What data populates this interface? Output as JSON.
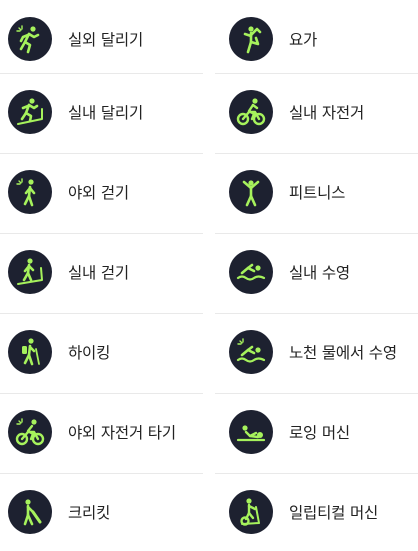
{
  "accent_color": "#a6f25c",
  "icon_bg_color": "#1d2130",
  "workouts": [
    {
      "id": "outdoor-run",
      "label": "실외 달리기",
      "icon": "outdoor-run-icon"
    },
    {
      "id": "yoga",
      "label": "요가",
      "icon": "yoga-icon"
    },
    {
      "id": "indoor-run",
      "label": "실내 달리기",
      "icon": "treadmill-run-icon"
    },
    {
      "id": "indoor-cycle",
      "label": "실내 자전거",
      "icon": "indoor-cycle-icon"
    },
    {
      "id": "outdoor-walk",
      "label": "야외 걷기",
      "icon": "outdoor-walk-icon"
    },
    {
      "id": "fitness",
      "label": "피트니스",
      "icon": "fitness-icon"
    },
    {
      "id": "indoor-walk",
      "label": "실내 걷기",
      "icon": "treadmill-walk-icon"
    },
    {
      "id": "pool-swim",
      "label": "실내 수영",
      "icon": "pool-swim-icon"
    },
    {
      "id": "hiking",
      "label": "하이킹",
      "icon": "hiking-icon"
    },
    {
      "id": "open-water-swim",
      "label": "노천 물에서 수영",
      "icon": "open-water-swim-icon"
    },
    {
      "id": "outdoor-cycle",
      "label": "야외 자전거 타기",
      "icon": "outdoor-cycle-icon"
    },
    {
      "id": "rowing",
      "label": "로잉 머신",
      "icon": "rowing-machine-icon"
    },
    {
      "id": "cricket",
      "label": "크리킷",
      "icon": "cricket-icon"
    },
    {
      "id": "elliptical",
      "label": "일립티컬 머신",
      "icon": "elliptical-icon"
    }
  ]
}
